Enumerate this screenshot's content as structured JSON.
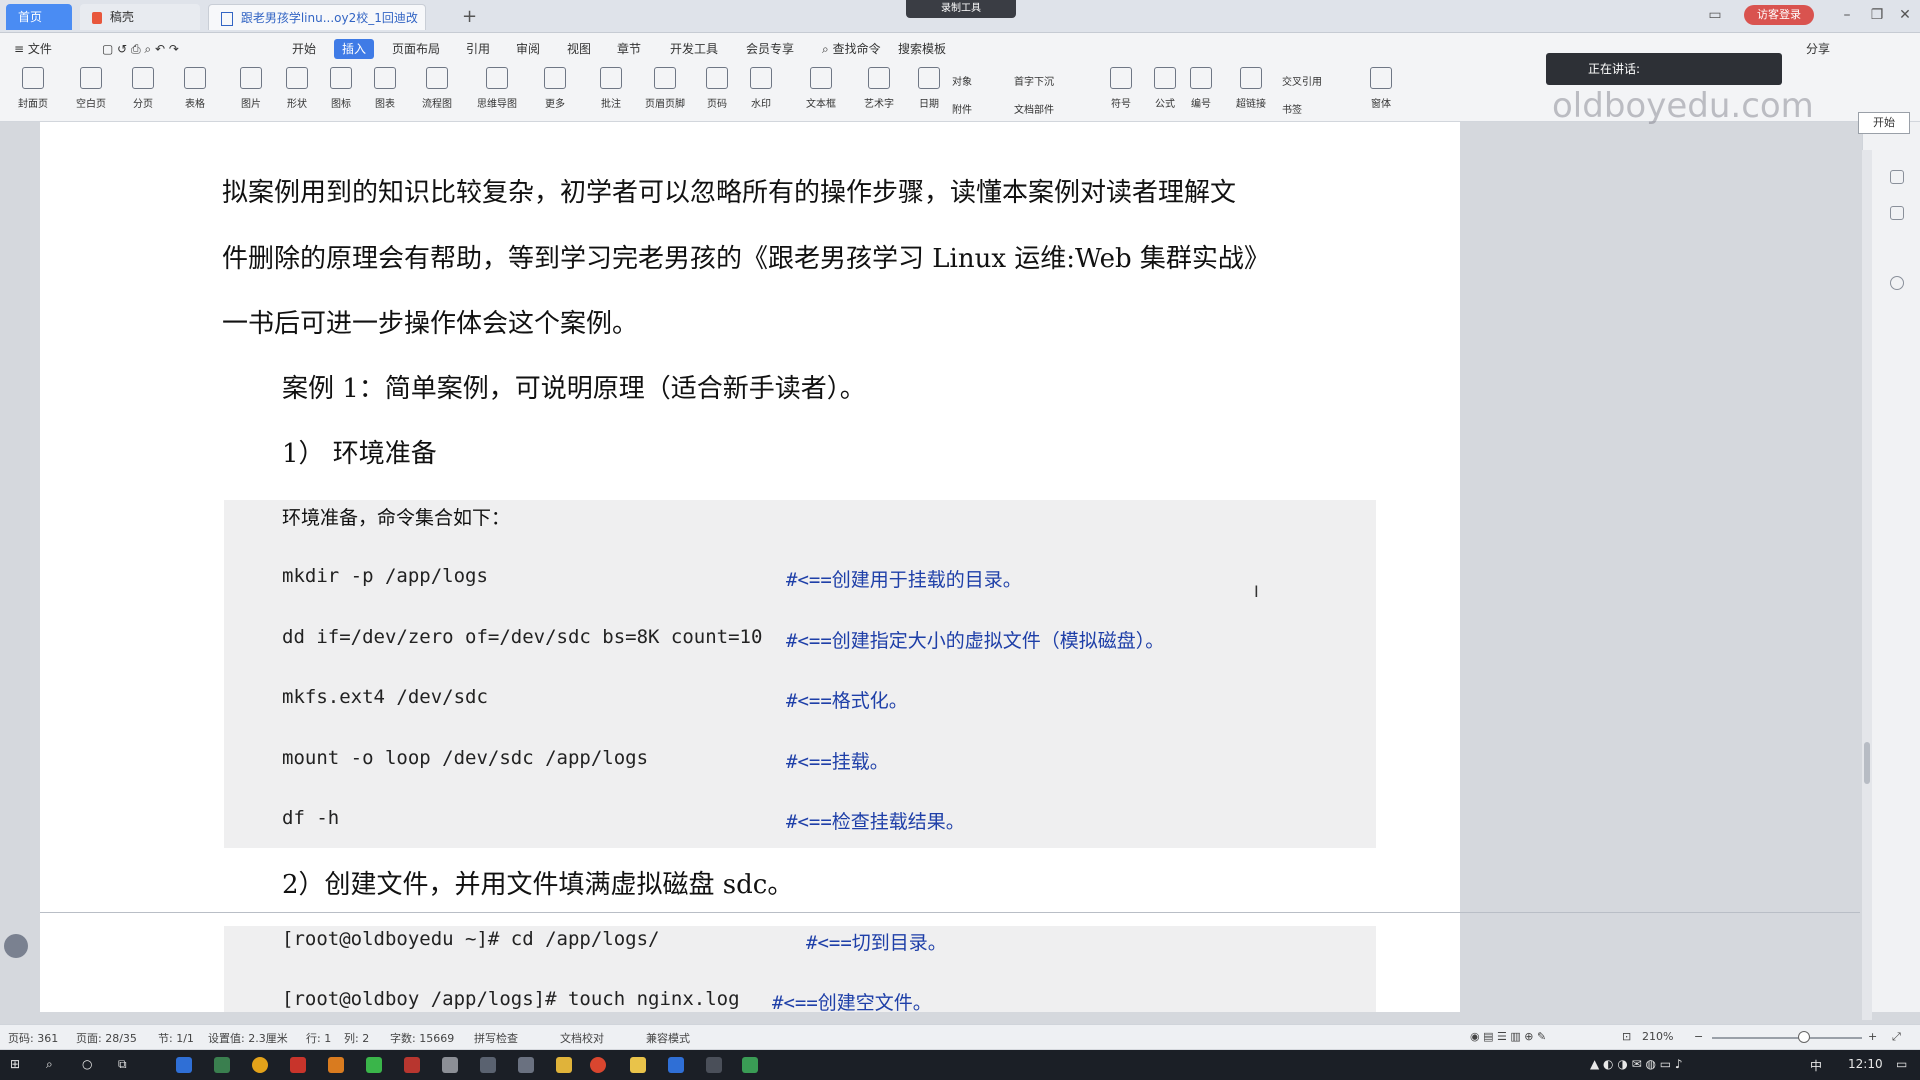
{
  "titlebar": {
    "tabs": [
      {
        "label": "首页"
      },
      {
        "label": "稿壳"
      },
      {
        "label": "跟老男孩学linu...oy2校_1回迪改"
      }
    ],
    "recording_label": "录制工具",
    "guest_label": "访客登录"
  },
  "menubar": {
    "items": [
      "≡ 文件",
      "开始",
      "插入",
      "页面布局",
      "引用",
      "审阅",
      "视图",
      "章节",
      "开发工具",
      "会员专享",
      "查找命令",
      "搜索模板"
    ],
    "active": "插入",
    "share": "分享"
  },
  "ribbon": {
    "buttons": [
      "封面页",
      "空白页",
      "分页",
      "表格",
      "图片",
      "形状",
      "图标",
      "图表",
      "流程图",
      "思维导图",
      "更多",
      "批注",
      "页眉页脚",
      "页码",
      "水印",
      "文本框",
      "艺术字",
      "日期",
      "符号",
      "公式",
      "编号",
      "超链接",
      "窗体"
    ],
    "small": [
      "对象",
      "首字下沉",
      "附件",
      "文档部件",
      "交叉引用",
      "书签"
    ]
  },
  "overlay": {
    "speaking": "正在讲话:",
    "logo": "oldboyedu.com",
    "start": "开始"
  },
  "document": {
    "para_lines": [
      "拟案例用到的知识比较复杂，初学者可以忽略所有的操作步骤，读懂本案例对读者理解文",
      "件删除的原理会有帮助，等到学习完老男孩的《跟老男孩学习 Linux 运维:Web 集群实战》",
      "一书后可进一步操作体会这个案例。"
    ],
    "case_title": "案例 1：简单案例，可说明原理（适合新手读者）。",
    "step1": "1） 环境准备",
    "code_intro": "环境准备，命令集合如下：",
    "code_lines": [
      {
        "cmd": "mkdir -p /app/logs",
        "comment": "#<==创建用于挂载的目录。"
      },
      {
        "cmd": "dd if=/dev/zero of=/dev/sdc bs=8K  count=10",
        "comment": "#<==创建指定大小的虚拟文件（模拟磁盘）。"
      },
      {
        "cmd": "mkfs.ext4 /dev/sdc",
        "comment": "#<==格式化。"
      },
      {
        "cmd": "mount -o loop /dev/sdc /app/logs",
        "comment": "#<==挂载。"
      },
      {
        "cmd": "df -h",
        "comment": "#<==检查挂载结果。"
      }
    ],
    "step2": "2）创建文件，并用文件填满虚拟磁盘 sdc。",
    "code2_lines": [
      {
        "cmd": "[root@oldboyedu ~]# cd /app/logs/",
        "comment": "#<==切到目录。"
      },
      {
        "cmd": "[root@oldboy /app/logs]# touch nginx.log",
        "comment": "#<==创建空文件。"
      }
    ]
  },
  "statusbar": {
    "items": [
      "页码: 361",
      "页面: 28/35",
      "节: 1/1",
      "设置值: 2.3厘米",
      "行: 1",
      "列: 2",
      "字数: 15669",
      "拼写检查",
      "文档校对",
      "兼容模式"
    ],
    "zoom": "210%"
  },
  "taskbar": {
    "time": "12:10",
    "ime": "中"
  }
}
